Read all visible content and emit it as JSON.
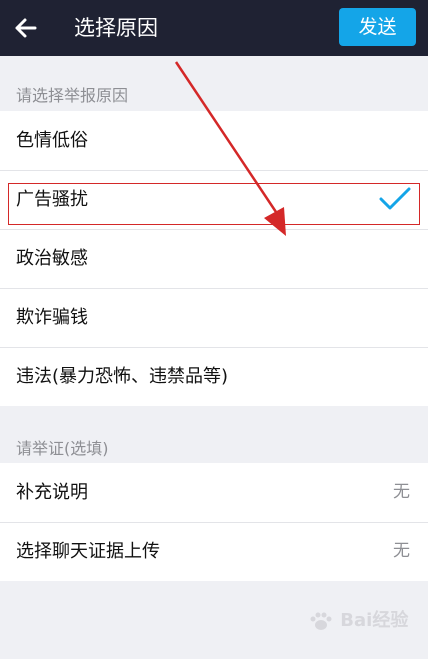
{
  "header": {
    "title": "选择原因",
    "send_label": "发送"
  },
  "reasons": {
    "heading": "请选择举报原因",
    "items": [
      {
        "label": "色情低俗"
      },
      {
        "label": "广告骚扰"
      },
      {
        "label": "政治敏感"
      },
      {
        "label": "欺诈骗钱"
      },
      {
        "label": "违法(暴力恐怖、违禁品等)"
      }
    ],
    "selected": "广告骚扰"
  },
  "evidence": {
    "heading": "请举证(选填)",
    "items": [
      {
        "label": "补充说明",
        "value": "无"
      },
      {
        "label": "选择聊天证据上传",
        "value": "无"
      }
    ]
  },
  "watermark": {
    "text": "Bai经验"
  },
  "colors": {
    "topbar": "#1f2233",
    "accent": "#14a5e8",
    "annotation": "#d42828"
  }
}
